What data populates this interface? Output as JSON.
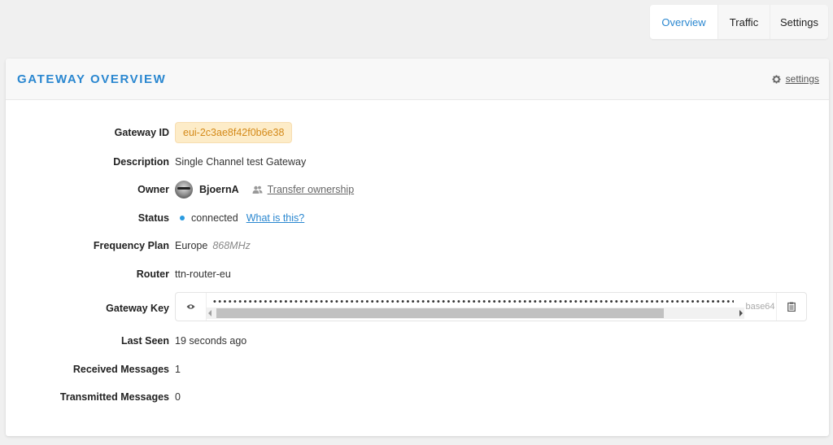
{
  "tabs": [
    {
      "label": "Overview",
      "active": true
    },
    {
      "label": "Traffic",
      "active": false
    },
    {
      "label": "Settings",
      "active": false
    }
  ],
  "card": {
    "title": "GATEWAY OVERVIEW",
    "settings_link": "settings",
    "settings_icon": "gear-icon"
  },
  "fields": {
    "gateway_id": {
      "label": "Gateway ID",
      "value": "eui-2c3ae8f42f0b6e38"
    },
    "description": {
      "label": "Description",
      "value": "Single Channel test Gateway"
    },
    "owner": {
      "label": "Owner",
      "name": "BjoernA",
      "transfer_link": "Transfer ownership",
      "transfer_icon": "users-icon"
    },
    "status": {
      "label": "Status",
      "value": "connected",
      "help_link": "What is this?",
      "indicator_color": "#2a9be0"
    },
    "frequency_plan": {
      "label": "Frequency Plan",
      "region": "Europe",
      "band": "868MHz"
    },
    "router": {
      "label": "Router",
      "value": "ttn-router-eu"
    },
    "gateway_key": {
      "label": "Gateway Key",
      "masked_value": "••••••••••••••••••••••••••••••••••••••••••••••••••••••••••••••••••••••••••••••••••••••••••••••••••••••••••",
      "format": "base64",
      "reveal_icon": "eye-icon",
      "copy_icon": "clipboard-icon"
    },
    "last_seen": {
      "label": "Last Seen",
      "value": "19 seconds ago"
    },
    "received_messages": {
      "label": "Received Messages",
      "value": "1"
    },
    "transmitted_messages": {
      "label": "Transmitted Messages",
      "value": "0"
    }
  },
  "colors": {
    "accent": "#2a87d0",
    "badge_bg": "#fdecc8",
    "badge_text": "#d48a1a"
  }
}
